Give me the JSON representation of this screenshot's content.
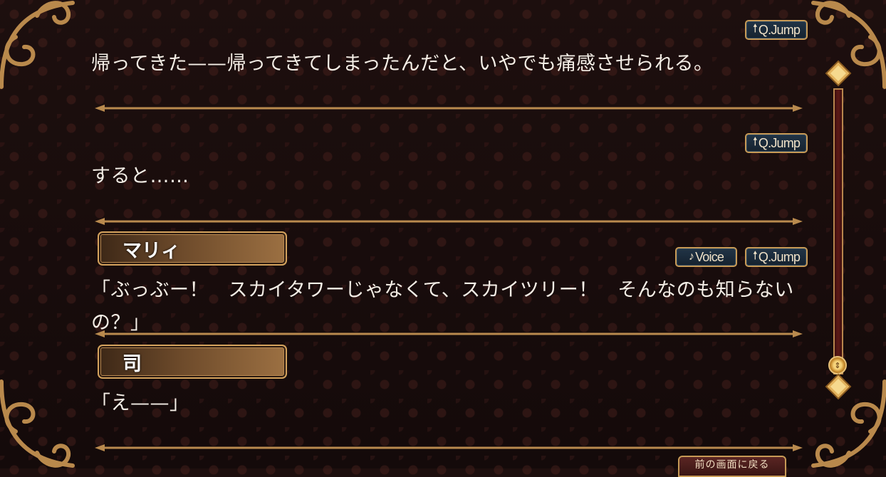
{
  "entries": [
    {
      "speaker": "",
      "text": "帰ってきた——帰ってきてしまったんだと、いやでも痛感させられる。",
      "buttons": {
        "jump": "Q.Jump"
      }
    },
    {
      "speaker": "",
      "text": "すると……",
      "buttons": {
        "jump": "Q.Jump"
      }
    },
    {
      "speaker": "マリィ",
      "text": "「ぶっぶー！　スカイタワーじゃなくて、スカイツリー！　そんなのも知らないの？」",
      "buttons": {
        "voice": "Voice",
        "jump": "Q.Jump"
      }
    },
    {
      "speaker": "司",
      "text": "「え——」"
    }
  ],
  "icons": {
    "jump": "up-arrow-icon",
    "voice": "music-note-icon",
    "scroll_up": "diamond-up-icon",
    "scroll_down": "diamond-down-icon",
    "scroll_thumb": "double-arrow-icon"
  },
  "footer": {
    "back_label": "前の画面に戻る"
  },
  "colors": {
    "background": "#1a0d0c",
    "gold": "#c79a56",
    "button_fill": "#1c2c3c",
    "text": "#f4eee6"
  }
}
